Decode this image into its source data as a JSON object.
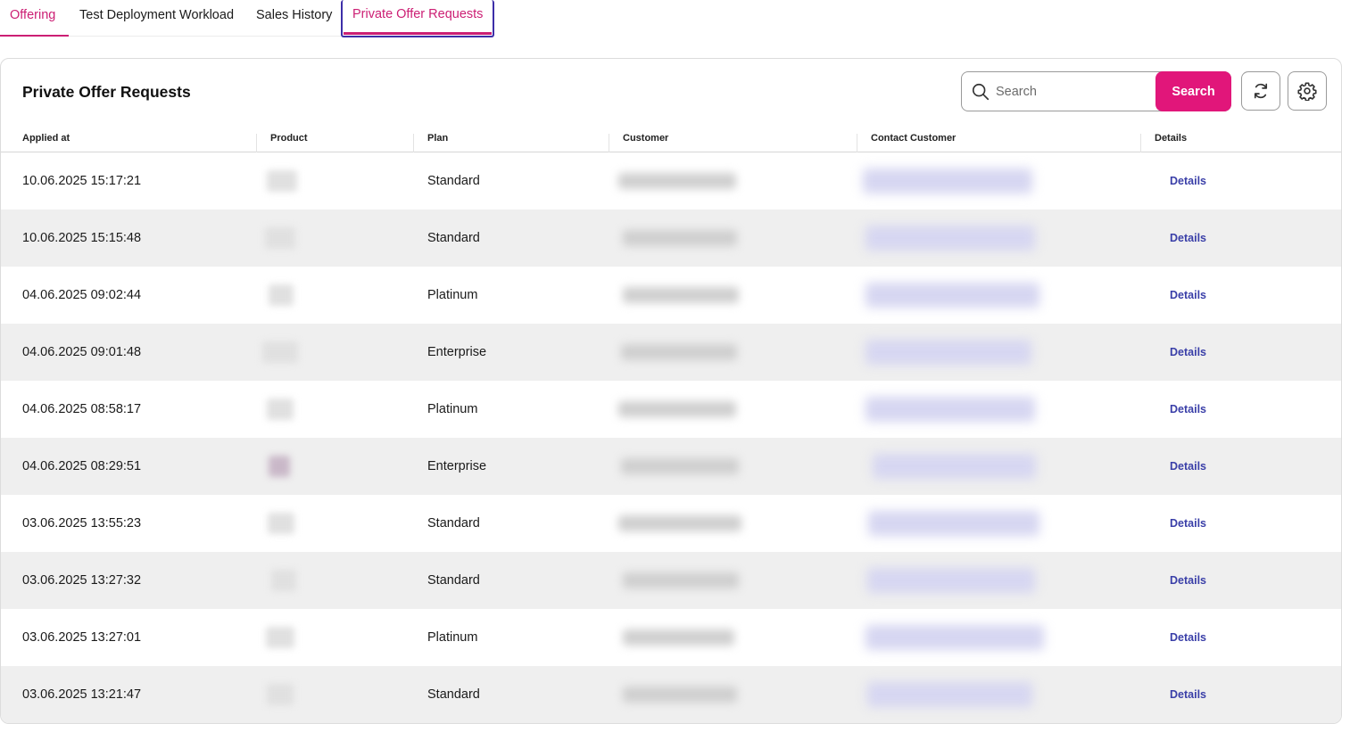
{
  "tabs": [
    {
      "label": "Offering"
    },
    {
      "label": "Test Deployment Workload"
    },
    {
      "label": "Sales History"
    },
    {
      "label": "Private Offer Requests"
    }
  ],
  "card": {
    "title": "Private Offer Requests",
    "search": {
      "placeholder": "Search",
      "value": "",
      "button_label": "Search"
    }
  },
  "table": {
    "columns": [
      "Applied at",
      "Product",
      "Plan",
      "Customer",
      "Contact Customer",
      "Details"
    ],
    "rows": [
      {
        "applied_at": "10.06.2025 15:17:21",
        "plan": "Standard",
        "details": "Details"
      },
      {
        "applied_at": "10.06.2025 15:15:48",
        "plan": "Standard",
        "details": "Details"
      },
      {
        "applied_at": "04.06.2025 09:02:44",
        "plan": "Platinum",
        "details": "Details"
      },
      {
        "applied_at": "04.06.2025 09:01:48",
        "plan": "Enterprise",
        "details": "Details"
      },
      {
        "applied_at": "04.06.2025 08:58:17",
        "plan": "Platinum",
        "details": "Details"
      },
      {
        "applied_at": "04.06.2025 08:29:51",
        "plan": "Enterprise",
        "details": "Details"
      },
      {
        "applied_at": "03.06.2025 13:55:23",
        "plan": "Standard",
        "details": "Details"
      },
      {
        "applied_at": "03.06.2025 13:27:32",
        "plan": "Standard",
        "details": "Details"
      },
      {
        "applied_at": "03.06.2025 13:27:01",
        "plan": "Platinum",
        "details": "Details"
      },
      {
        "applied_at": "03.06.2025 13:21:47",
        "plan": "Standard",
        "details": "Details"
      }
    ]
  },
  "colors": {
    "brand_magenta": "#e1167a",
    "tab_active_text": "#cc1f74",
    "focus_ring": "#3d2ea8",
    "link": "#3a3fa8",
    "row_alt": "#efefef"
  },
  "icons": [
    "search-icon",
    "refresh-icon",
    "gear-icon"
  ]
}
